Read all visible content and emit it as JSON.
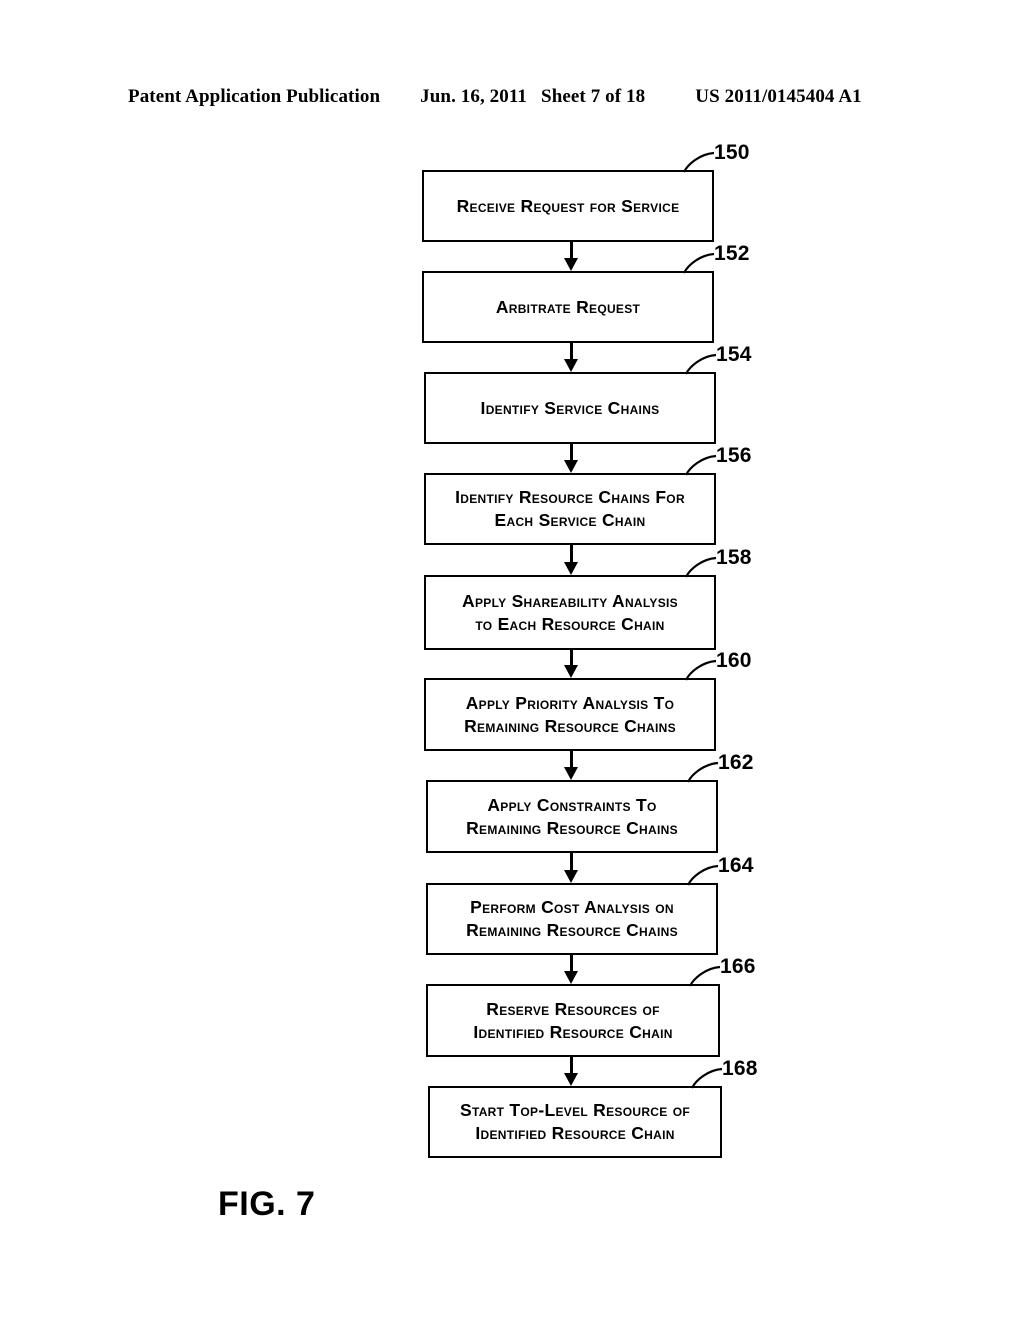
{
  "header": {
    "publication": "Patent Application Publication",
    "date": "Jun. 16, 2011",
    "sheet": "Sheet 7 of 18",
    "patent_number": "US 2011/0145404 A1"
  },
  "figure": {
    "caption": "FIG. 7",
    "type": "flowchart",
    "steps": [
      {
        "ref": "150",
        "text": "Receive Request for Service"
      },
      {
        "ref": "152",
        "text": "Arbitrate Request"
      },
      {
        "ref": "154",
        "text": "Identify Service Chains"
      },
      {
        "ref": "156",
        "text": "Identify Resource Chains For\nEach Service Chain"
      },
      {
        "ref": "158",
        "text": "Apply Shareability Analysis\nto Each Resource Chain"
      },
      {
        "ref": "160",
        "text": "Apply Priority Analysis To\nRemaining Resource Chains"
      },
      {
        "ref": "162",
        "text": "Apply Constraints To\nRemaining Resource Chains"
      },
      {
        "ref": "164",
        "text": "Perform Cost Analysis on\nRemaining Resource Chains"
      },
      {
        "ref": "166",
        "text": "Reserve Resources of\nIdentified Resource Chain"
      },
      {
        "ref": "168",
        "text": "Start Top-Level Resource of\nIdentified Resource Chain"
      }
    ]
  },
  "colors": {
    "ink": "#000000",
    "paper": "#ffffff"
  }
}
